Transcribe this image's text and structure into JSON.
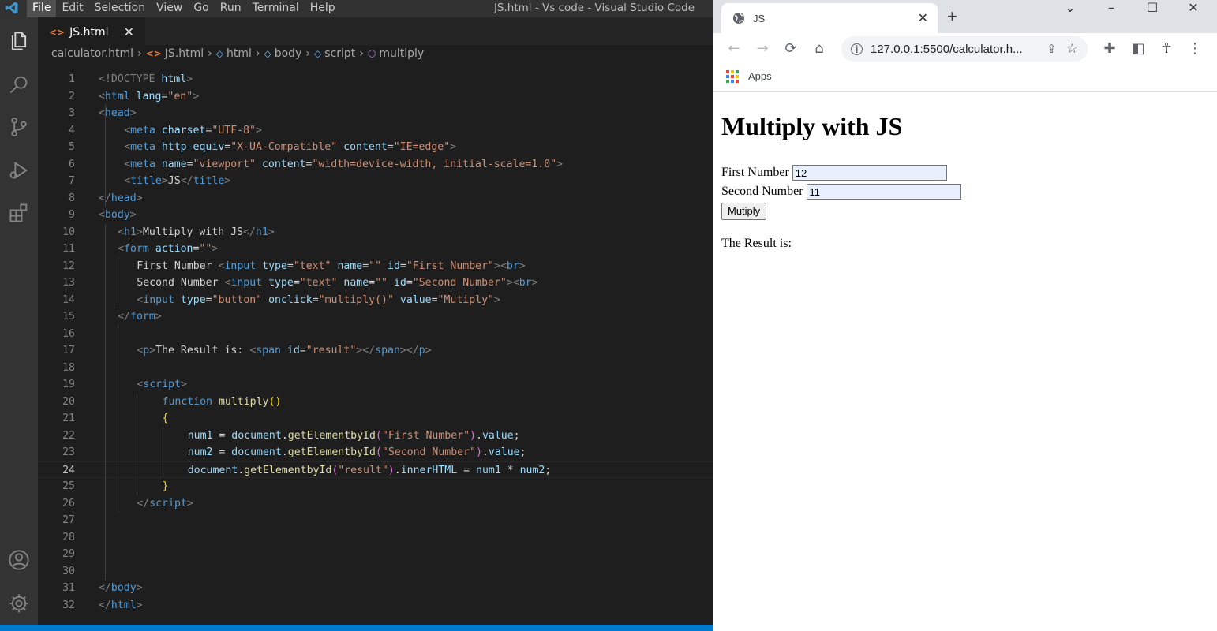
{
  "vscode": {
    "menu": [
      "File",
      "Edit",
      "Selection",
      "View",
      "Go",
      "Run",
      "Terminal",
      "Help"
    ],
    "window_title": "JS.html - Vs code - Visual Studio Code",
    "tab": {
      "label": "JS.html"
    },
    "breadcrumb": [
      "calculator.html",
      "JS.html",
      "html",
      "body",
      "script",
      "multiply"
    ],
    "current_line": 24,
    "lines": [
      "1",
      "2",
      "3",
      "4",
      "5",
      "6",
      "7",
      "8",
      "9",
      "10",
      "11",
      "12",
      "13",
      "14",
      "15",
      "16",
      "17",
      "18",
      "19",
      "20",
      "21",
      "22",
      "23",
      "24",
      "25",
      "26",
      "27",
      "28",
      "29",
      "30",
      "31",
      "32"
    ],
    "code": {
      "l1": [
        "<!DOCTYPE ",
        "html",
        ">"
      ],
      "l2": [
        "<",
        "html",
        " ",
        "lang",
        "=",
        "\"en\"",
        ">"
      ],
      "l3": [
        "<",
        "head",
        ">"
      ],
      "l4": [
        "<",
        "meta",
        " ",
        "charset",
        "=",
        "\"UTF-8\"",
        ">"
      ],
      "l5": [
        "<",
        "meta",
        " ",
        "http-equiv",
        "=",
        "\"X-UA-Compatible\"",
        " ",
        "content",
        "=",
        "\"IE=edge\"",
        ">"
      ],
      "l6": [
        "<",
        "meta",
        " ",
        "name",
        "=",
        "\"viewport\"",
        " ",
        "content",
        "=",
        "\"width=device-width, initial-scale=1.0\"",
        ">"
      ],
      "l7": [
        "<",
        "title",
        ">",
        "JS",
        "</",
        "title",
        ">"
      ],
      "l8": [
        "</",
        "head",
        ">"
      ],
      "l9": [
        "<",
        "body",
        ">"
      ],
      "l10": [
        "<",
        "h1",
        ">",
        "Multiply with JS",
        "</",
        "h1",
        ">"
      ],
      "l11": [
        "<",
        "form",
        " ",
        "action",
        "=",
        "\"\"",
        ">"
      ],
      "l12": [
        "First Number ",
        "<",
        "input",
        " ",
        "type",
        "=",
        "\"text\"",
        " ",
        "name",
        "=",
        "\"\"",
        " ",
        "id",
        "=",
        "\"First Number\"",
        ">",
        "<",
        "br",
        ">"
      ],
      "l13": [
        "Second Number ",
        "<",
        "input",
        " ",
        "type",
        "=",
        "\"text\"",
        " ",
        "name",
        "=",
        "\"\"",
        " ",
        "id",
        "=",
        "\"Second Number\"",
        ">",
        "<",
        "br",
        ">"
      ],
      "l14": [
        "<",
        "input",
        " ",
        "type",
        "=",
        "\"button\"",
        " ",
        "onclick",
        "=",
        "\"multiply()\"",
        " ",
        "value",
        "=",
        "\"Mutiply\"",
        ">"
      ],
      "l15": [
        "</",
        "form",
        ">"
      ],
      "l17": [
        "<",
        "p",
        ">",
        "The Result is: ",
        "<",
        "span",
        " ",
        "id",
        "=",
        "\"result\"",
        ">",
        "</",
        "span",
        ">",
        "</",
        "p",
        ">"
      ],
      "l19": [
        "<",
        "script",
        ">"
      ],
      "l20": [
        "function",
        " ",
        "multiply",
        "(",
        ")"
      ],
      "l21": [
        "{"
      ],
      "l22": [
        "num1",
        " = ",
        "document",
        ".",
        "getElementbyId",
        "(",
        "\"First Number\"",
        ")",
        ".",
        "value",
        ";"
      ],
      "l23": [
        "num2",
        " = ",
        "document",
        ".",
        "getElementbyId",
        "(",
        "\"Second Number\"",
        ")",
        ".",
        "value",
        ";"
      ],
      "l24": [
        "document",
        ".",
        "getElementbyId",
        "(",
        "\"result\"",
        ")",
        ".",
        "innerHTML",
        " = ",
        "num1",
        " * ",
        "num2",
        ";"
      ],
      "l25": [
        "}"
      ],
      "l26": [
        "</",
        "script",
        ">"
      ],
      "l31": [
        "</",
        "body",
        ">"
      ],
      "l32": [
        "</",
        "html",
        ">"
      ]
    }
  },
  "chrome": {
    "tab_title": "JS",
    "url": "127.0.0.1:5500/calculator.h...",
    "bookmarks": {
      "apps_label": "Apps"
    },
    "page": {
      "heading": "Multiply with JS",
      "first_label": "First Number",
      "first_value": "12",
      "second_label": "Second Number",
      "second_value": "11",
      "button_label": "Mutiply",
      "result_label": "The Result is:"
    }
  }
}
